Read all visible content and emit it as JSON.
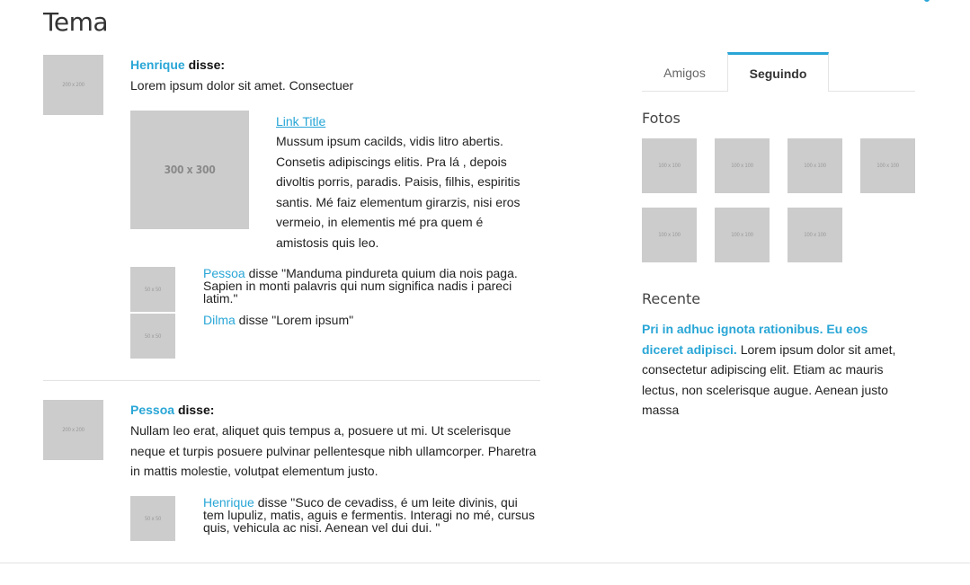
{
  "page": {
    "title": "Tema"
  },
  "comments": [
    {
      "avatar_label": "200 x 200",
      "author": "Henrique",
      "said": "disse:",
      "body": "Lorem ipsum dolor sit amet. Consectuer",
      "media": {
        "image_label": "300 x 300",
        "title": "Link Title",
        "text": "Mussum ipsum cacilds, vidis litro abertis. Consetis adipiscings elitis. Pra lá , depois divoltis porris, paradis. Paisis, filhis, espiritis santis. Mé faiz elementum girarzis, nisi eros vermeio, in elementis mé pra quem é amistosis quis leo."
      },
      "replies": [
        {
          "avatar_label": "50 x 50",
          "author": "Pessoa",
          "text": " disse \"Manduma pindureta quium dia nois paga. Sapien in monti palavris qui num significa nadis i pareci latim.\""
        },
        {
          "avatar_label": "50 x 50",
          "author": "Dilma",
          "text": " disse \"Lorem ipsum\""
        }
      ]
    },
    {
      "avatar_label": "200 x 200",
      "author": "Pessoa",
      "said": "disse:",
      "body": "Nullam leo erat, aliquet quis tempus a, posuere ut mi. Ut scelerisque neque et turpis posuere pulvinar pellentesque nibh ullamcorper. Pharetra in mattis molestie, volutpat elementum justo.",
      "replies": [
        {
          "avatar_label": "50 x 50",
          "author": "Henrique",
          "text": " disse \"Suco de cevadiss, é um leite divinis, qui tem lupuliz, matis, aguis e fermentis. Interagi no mé, cursus quis, vehicula ac nisi. Aenean vel dui dui. \""
        }
      ]
    }
  ],
  "sidebar": {
    "tabs": [
      {
        "label": "Amigos",
        "active": false
      },
      {
        "label": "Seguindo",
        "active": true
      }
    ],
    "photos_heading": "Fotos",
    "photo_labels": [
      "100 x 100",
      "100 x 100",
      "100 x 100",
      "100 x 100",
      "100 x 100",
      "100 x 100",
      "100 x 100"
    ],
    "recent_heading": "Recente",
    "recent": {
      "title": "Pri in adhuc ignota rationibus. Eu eos diceret adipisci.",
      "text": " Lorem ipsum dolor sit amet, consectetur adipiscing elit. Etiam ac mauris lectus, non scelerisque augue. Aenean justo massa"
    }
  },
  "colors": {
    "accent": "#29a6d6",
    "placeholder": "#cccccc",
    "divider": "#e3e3e3"
  }
}
